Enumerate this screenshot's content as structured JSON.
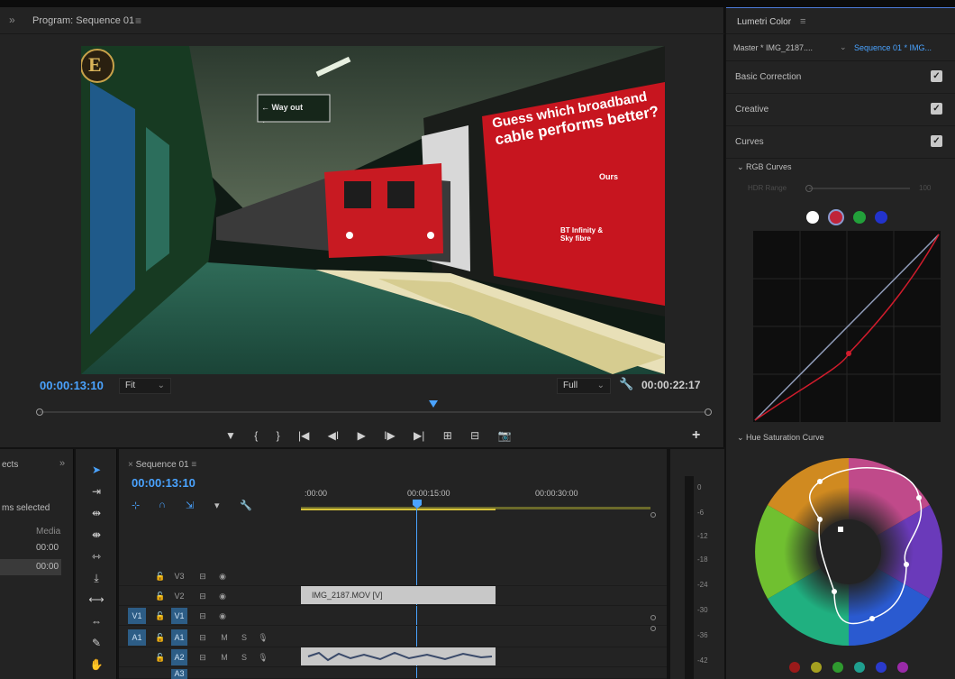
{
  "program": {
    "chevron": "»",
    "title": "Program: Sequence 01",
    "menu": "≡",
    "timecode_current": "00:00:13:10",
    "timecode_duration": "00:00:22:17",
    "zoom": "Fit",
    "resolution": "Full",
    "add": "+",
    "transport": [
      "▼",
      "{",
      "}",
      "|◀",
      "◀I",
      "▶",
      "I▶",
      "▶|",
      "⊞",
      "⊟",
      "📷"
    ]
  },
  "video": {
    "logo_letter": "E",
    "sign": "← Way out",
    "ad_line1": "Guess which broadband",
    "ad_line2": "cable performs better?",
    "ad_ours": "Ours",
    "ad_bt": "BT Infinity & Sky fibre"
  },
  "lumetri": {
    "title": "Lumetri Color",
    "menu": "≡",
    "master_tab": "Master * IMG_2187....",
    "sequence_tab": "Sequence 01 * IMG...",
    "sections": [
      "Basic Correction",
      "Creative",
      "Curves"
    ],
    "rgb_curves": "RGB Curves",
    "hdr_range_label": "HDR Range",
    "hdr_range_value": "100",
    "hue_sat": "Hue Saturation Curve",
    "channel_colors": [
      "#ffffff",
      "#c0243a",
      "#22a03a",
      "#2233cc"
    ],
    "swatch_colors": [
      "#9a1a1a",
      "#a5a020",
      "#2f9a2f",
      "#1f9f8f",
      "#2a3acc",
      "#9a2aa8"
    ]
  },
  "effects": {
    "title": "ects",
    "chev": "»",
    "selected": "ms selected",
    "col": "Media",
    "rows": [
      "00:00",
      "00:00"
    ]
  },
  "timeline": {
    "tab": "Sequence 01",
    "menu": "≡",
    "timecode": "00:00:13:10",
    "ruler": [
      ":00:00",
      "00:00:15:00",
      "00:00:30:00"
    ],
    "video_tracks": [
      "V3",
      "V2",
      "V1"
    ],
    "audio_tracks": [
      "A1",
      "A2",
      "A3"
    ],
    "src_v": "V1",
    "src_a": "A1",
    "clip_label": "IMG_2187.MOV [V]"
  },
  "meter": {
    "labels": [
      "0",
      "-6",
      "-12",
      "-18",
      "-24",
      "-30",
      "-36",
      "-42"
    ]
  }
}
